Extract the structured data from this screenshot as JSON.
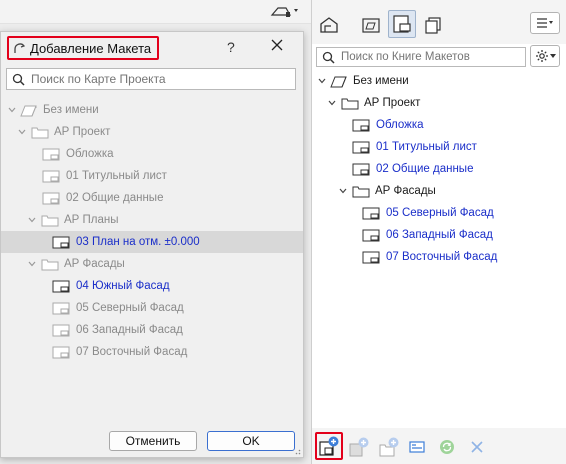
{
  "dialog": {
    "title": "Добавление Макета",
    "help_label": "?",
    "search_placeholder": "Поиск по Карте Проекта",
    "cancel_label": "Отменить",
    "ok_label": "OK",
    "tree": [
      {
        "label": "Без имени"
      },
      {
        "label": "АР Проект"
      },
      {
        "label": "Обложка"
      },
      {
        "label": "01 Титульный лист"
      },
      {
        "label": "02 Общие данные"
      },
      {
        "label": "АР Планы"
      },
      {
        "label": "03 План на отм. ±0.000"
      },
      {
        "label": "АР Фасады"
      },
      {
        "label": "04 Южный Фасад"
      },
      {
        "label": "05 Северный Фасад"
      },
      {
        "label": "06 Западный Фасад"
      },
      {
        "label": "07 Восточный Фасад"
      }
    ]
  },
  "panel": {
    "search_placeholder": "Поиск по Книге Макетов",
    "tree": [
      {
        "label": "Без имени"
      },
      {
        "label": "АР Проект"
      },
      {
        "label": "Обложка"
      },
      {
        "label": "01 Титульный лист"
      },
      {
        "label": "02 Общие данные"
      },
      {
        "label": "АР Фасады"
      },
      {
        "label": "05 Северный Фасад"
      },
      {
        "label": "06 Западный Фасад"
      },
      {
        "label": "07 Восточный Фасад"
      }
    ]
  },
  "colors": {
    "highlight_frame": "#e3001b",
    "link_blue": "#1a2ec9",
    "selected_row": "#d8d8d8",
    "disabled_gray": "#8a8a8a"
  },
  "icons": {
    "dialog_title": "layout-arc-icon",
    "search": "search-icon",
    "close": "close-icon",
    "project_root": "book-icon",
    "folder": "folder-icon",
    "layout": "layout-sheet-icon",
    "settings": "gear-icon",
    "menu": "menu-icon",
    "new_layout": "new-layout-icon"
  }
}
